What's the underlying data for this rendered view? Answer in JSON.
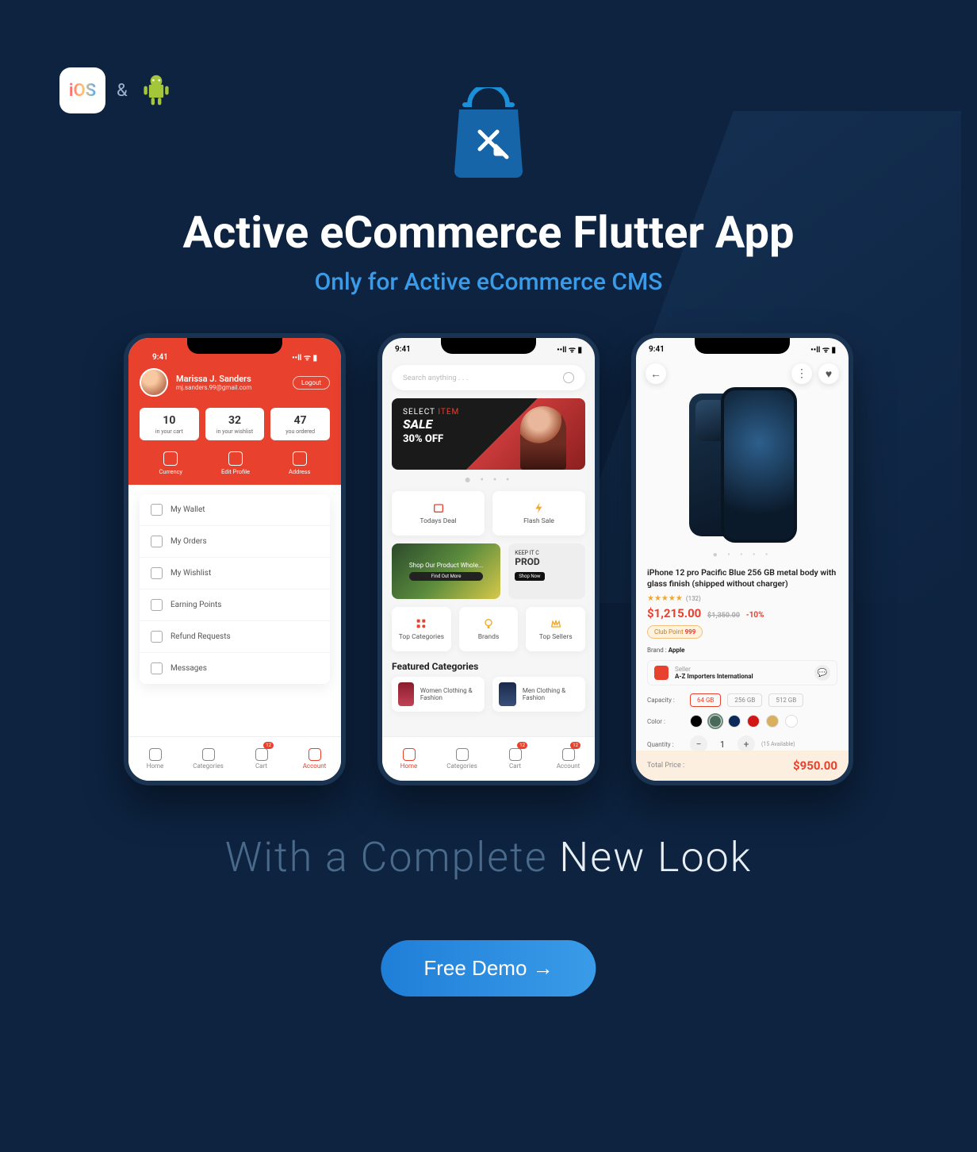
{
  "header": {
    "ios_label": "iOS",
    "ampersand": "&",
    "title": "Active eCommerce Flutter App",
    "subtitle": "Only for Active eCommerce CMS"
  },
  "phone1": {
    "time": "9:41",
    "status_icons": "••ll ᯤ ▮",
    "user": {
      "name": "Marissa J. Sanders",
      "email": "mj.sanders.99@gmail.com"
    },
    "logout": "Logout",
    "stats": [
      {
        "num": "10",
        "label": "in your cart"
      },
      {
        "num": "32",
        "label": "in your wishlist"
      },
      {
        "num": "47",
        "label": "you ordered"
      }
    ],
    "actions": [
      "Currency",
      "Edit Profile",
      "Address"
    ],
    "menu": [
      "My Wallet",
      "My Orders",
      "My Wishlist",
      "Earning Points",
      "Refund Requests",
      "Messages"
    ]
  },
  "phone2": {
    "time": "9:41",
    "status_icons": "••ll ᯤ ▮",
    "search_placeholder": "Search anything . . .",
    "banner": {
      "line1_a": "SELECT",
      "line1_b": "ITEM",
      "sale": "SALE",
      "off": "30% OFF"
    },
    "tiles_top": [
      "Todays Deal",
      "Flash Sale"
    ],
    "strip_a": {
      "text": "Shop Our Product Whole...",
      "cta": "Find Out More"
    },
    "strip_b": {
      "small": "KEEP IT C",
      "big": "PROD",
      "cta": "Shop Now"
    },
    "tiles_mid": [
      "Top Categories",
      "Brands",
      "Top Sellers"
    ],
    "section": "Featured Categories",
    "cats": [
      "Women Clothing & Fashion",
      "Men Clothing & Fashion"
    ]
  },
  "phone3": {
    "time": "9:41",
    "status_icons": "••ll ᯤ ▮",
    "title": "iPhone 12 pro Pacific Blue 256 GB metal body with glass finish (shipped without charger)",
    "stars": "★★★★★",
    "rating_count": "(132)",
    "price": "$1,215.00",
    "old_price": "$1,350.00",
    "discount": "-10%",
    "club_label": "Club Point",
    "club_value": "999",
    "brand_label": "Brand :",
    "brand_value": "Apple",
    "seller_label": "Seller",
    "seller_name": "A-Z Importers International",
    "cap_label": "Capacity :",
    "caps": [
      "64 GB",
      "256 GB",
      "512 GB"
    ],
    "color_label": "Color :",
    "colors": [
      "#000",
      "#4a6b5b",
      "#0b2a5a",
      "#d11616",
      "#d8b060",
      "#fff"
    ],
    "qty_label": "Quantity :",
    "qty_value": "1",
    "available": "(15 Available)",
    "total_label": "Total Price :",
    "total_value": "$950.00"
  },
  "tabs": [
    {
      "label": "Home"
    },
    {
      "label": "Categories"
    },
    {
      "label": "Cart",
      "badge": "12"
    },
    {
      "label": "Account",
      "badge": "12"
    }
  ],
  "tagline": {
    "dim": "With  a Complete",
    "bright": "New Look"
  },
  "cta": "Free Demo →"
}
